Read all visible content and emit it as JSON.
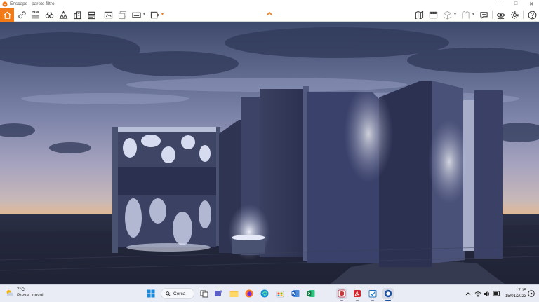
{
  "window": {
    "title": "Enscape - parete filtro",
    "controls": [
      "–",
      "□",
      "✕"
    ]
  },
  "toolbar": {
    "home_icon": "home-icon",
    "bim_label": "BIM",
    "left_tools": [
      "link-icon",
      "bim-icon",
      "binoculars-icon",
      "cube-perspective-icon",
      "buildings-icon",
      "clapperboard-icon",
      "screenshot-icon",
      "batch-render-icon",
      "panorama-icon",
      "export-icon"
    ],
    "right_tools": [
      "map-icon",
      "video-editor-icon",
      "asset-library-icon",
      "material-editor-icon",
      "feedback-icon",
      "visual-settings-icon",
      "settings-icon",
      "help-icon"
    ],
    "accent_color": "#f07a18"
  },
  "taskbar": {
    "weather": {
      "temp": "7°C",
      "condition": "Preval. nuvol."
    },
    "search_label": "Cerca",
    "apps": [
      "windows-start-icon",
      "task-view-icon",
      "teams-icon",
      "file-explorer-icon",
      "firefox-icon",
      "edge-icon",
      "store-icon",
      "word-icon",
      "excel-icon",
      "sketchup-icon",
      "acrobat-icon",
      "calendar-icon",
      "enscape-icon"
    ],
    "tray": [
      "chevron-up-icon",
      "wifi-icon",
      "volume-icon",
      "battery-icon"
    ],
    "time": "17:15",
    "date": "15/01/2023"
  }
}
